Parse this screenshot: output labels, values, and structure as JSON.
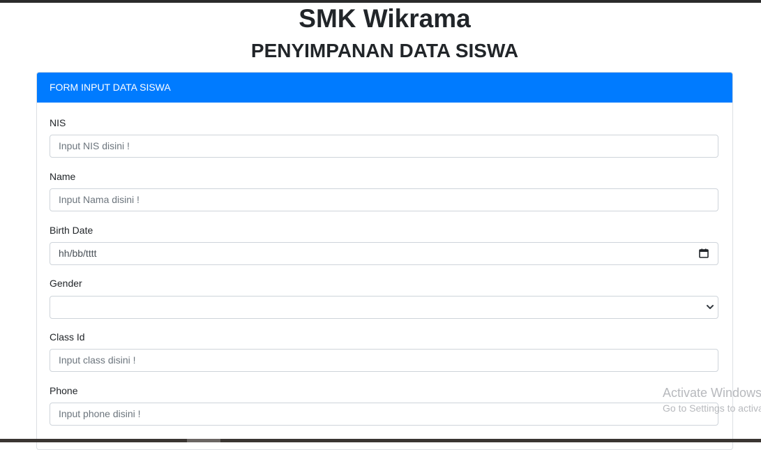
{
  "header": {
    "title": "SMK Wikrama",
    "subtitle": "PENYIMPANAN DATA SISWA"
  },
  "form": {
    "card_title": "FORM INPUT DATA SISWA",
    "fields": {
      "nis": {
        "label": "NIS",
        "placeholder": "Input NIS disini !",
        "value": ""
      },
      "name": {
        "label": "Name",
        "placeholder": "Input Nama disini !",
        "value": ""
      },
      "birth_date": {
        "label": "Birth Date",
        "display_format": "hh/bb/tttt",
        "icon": "calendar-icon"
      },
      "gender": {
        "label": "Gender",
        "selected": "",
        "icon": "chevron-down-icon"
      },
      "class_id": {
        "label": "Class Id",
        "placeholder": "Input class disini !",
        "value": ""
      },
      "phone": {
        "label": "Phone",
        "placeholder": "Input phone disini !",
        "value": ""
      }
    }
  },
  "watermark": {
    "line1": "Activate Windows",
    "line2": "Go to Settings to activate Windows."
  },
  "colors": {
    "header_bg": "#007bff",
    "header_text": "#ffffff",
    "input_border": "#ced4da"
  }
}
